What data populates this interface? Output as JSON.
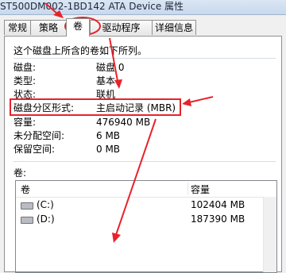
{
  "window": {
    "title": "ST500DM002-1BD142 ATA Device 属性"
  },
  "tabs": [
    "常规",
    "策略",
    "卷",
    "驱动程序",
    "详细信息"
  ],
  "intro": "这个磁盘上所含的卷如下所列。",
  "properties": [
    {
      "label": "磁盘:",
      "value": "磁盘 0"
    },
    {
      "label": "类型:",
      "value": "基本"
    },
    {
      "label": "状态:",
      "value": "联机"
    },
    {
      "label": "磁盘分区形式:",
      "value": "主启动记录 (MBR)"
    },
    {
      "label": "容量:",
      "value": "476940 MB"
    },
    {
      "label": "未分配空间:",
      "value": "6 MB"
    },
    {
      "label": "保留空间:",
      "value": "0 MB"
    }
  ],
  "volumes": {
    "section_label": "卷:",
    "columns": [
      "卷",
      "容量"
    ],
    "rows": [
      {
        "name": "(C:)",
        "size": "102404 MB"
      },
      {
        "name": "(D:)",
        "size": "187390 MB"
      }
    ]
  },
  "annotation": {
    "color": "#e8222a"
  }
}
